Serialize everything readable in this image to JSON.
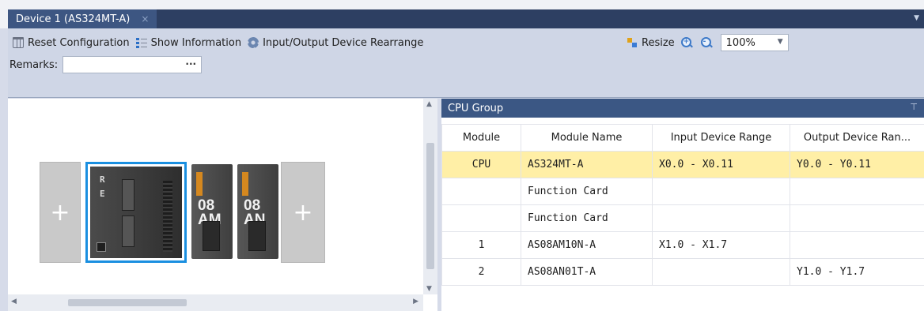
{
  "tab": {
    "title": "Device 1 (AS324MT-A)",
    "close": "×",
    "menu": "▼"
  },
  "toolbar": {
    "reset_label": "Reset Configuration",
    "show_info_label": "Show Information",
    "rearrange_label": "Input/Output Device Rearrange",
    "resize_label": "Resize",
    "zoom_value": "100%",
    "remarks_label": "Remarks:",
    "remarks_value": "",
    "remarks_browse": "···"
  },
  "hardware": {
    "add_slot_label": "+",
    "cpu_leds": [
      "R",
      "E"
    ],
    "modules": [
      {
        "line1": "08",
        "line2": "AM"
      },
      {
        "line1": "08",
        "line2": "AN"
      }
    ]
  },
  "cpu_group": {
    "title": "CPU Group",
    "pin": "ᵖ",
    "columns": [
      "Module",
      "Module Name",
      "Input Device Range",
      "Output Device Ran..."
    ],
    "rows": [
      {
        "module": "CPU",
        "name": "AS324MT-A",
        "input": "X0.0 - X0.11",
        "output": "Y0.0 - Y0.11"
      },
      {
        "module": "",
        "name": "Function Card",
        "input": "",
        "output": ""
      },
      {
        "module": "",
        "name": "Function Card",
        "input": "",
        "output": ""
      },
      {
        "module": "1",
        "name": "AS08AM10N-A",
        "input": "X1.0 - X1.7",
        "output": ""
      },
      {
        "module": "2",
        "name": "AS08AN01T-A",
        "input": "",
        "output": "Y1.0 - Y1.7"
      }
    ]
  },
  "colors": {
    "selected_row": "#ffefa6",
    "panel_header": "#3b5784",
    "cpu_selection": "#1a8fe0"
  }
}
